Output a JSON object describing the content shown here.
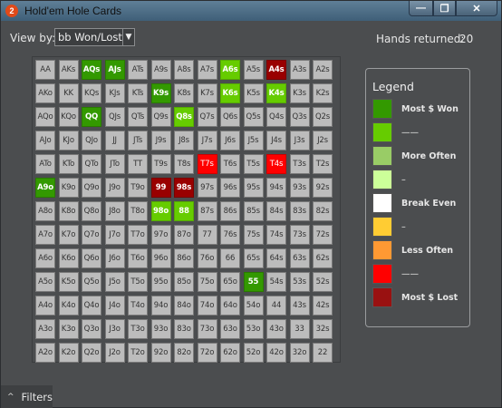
{
  "window": {
    "title": "Hold'em Hole Cards",
    "icon_symbol": "2",
    "controls": {
      "minimize": "—",
      "maximize": "❐",
      "close": "✕"
    }
  },
  "toolbar": {
    "view_by_label": "View by:",
    "view_by_value": "bb Won/Lost",
    "hands_returned_label": "Hands returned:",
    "hands_returned_value": "20"
  },
  "grid": {
    "rows": [
      [
        "AA",
        "AKs",
        "AQs",
        "AJs",
        "ATs",
        "A9s",
        "A8s",
        "A7s",
        "A6s",
        "A5s",
        "A4s",
        "A3s",
        "A2s"
      ],
      [
        "AKo",
        "KK",
        "KQs",
        "KJs",
        "KTs",
        "K9s",
        "K8s",
        "K7s",
        "K6s",
        "K5s",
        "K4s",
        "K3s",
        "K2s"
      ],
      [
        "AQo",
        "KQo",
        "QQ",
        "QJs",
        "QTs",
        "Q9s",
        "Q8s",
        "Q7s",
        "Q6s",
        "Q5s",
        "Q4s",
        "Q3s",
        "Q2s"
      ],
      [
        "AJo",
        "KJo",
        "QJo",
        "JJ",
        "JTs",
        "J9s",
        "J8s",
        "J7s",
        "J6s",
        "J5s",
        "J4s",
        "J3s",
        "J2s"
      ],
      [
        "ATo",
        "KTo",
        "QTo",
        "JTo",
        "TT",
        "T9s",
        "T8s",
        "T7s",
        "T6s",
        "T5s",
        "T4s",
        "T3s",
        "T2s"
      ],
      [
        "A9o",
        "K9o",
        "Q9o",
        "J9o",
        "T9o",
        "99",
        "98s",
        "97s",
        "96s",
        "95s",
        "94s",
        "93s",
        "92s"
      ],
      [
        "A8o",
        "K8o",
        "Q8o",
        "J8o",
        "T8o",
        "98o",
        "88",
        "87s",
        "86s",
        "85s",
        "84s",
        "83s",
        "82s"
      ],
      [
        "A7o",
        "K7o",
        "Q7o",
        "J7o",
        "T7o",
        "97o",
        "87o",
        "77",
        "76s",
        "75s",
        "74s",
        "73s",
        "72s"
      ],
      [
        "A6o",
        "K6o",
        "Q6o",
        "J6o",
        "T6o",
        "96o",
        "86o",
        "76o",
        "66",
        "65s",
        "64s",
        "63s",
        "62s"
      ],
      [
        "A5o",
        "K5o",
        "Q5o",
        "J5o",
        "T5o",
        "95o",
        "85o",
        "75o",
        "65o",
        "55",
        "54s",
        "53s",
        "52s"
      ],
      [
        "A4o",
        "K4o",
        "Q4o",
        "J4o",
        "T4o",
        "94o",
        "84o",
        "74o",
        "64o",
        "54o",
        "44",
        "43s",
        "42s"
      ],
      [
        "A3o",
        "K3o",
        "Q3o",
        "J3o",
        "T3o",
        "93o",
        "83o",
        "73o",
        "63o",
        "53o",
        "43o",
        "33",
        "32s"
      ],
      [
        "A2o",
        "K2o",
        "Q2o",
        "J2o",
        "T2o",
        "92o",
        "82o",
        "72o",
        "62o",
        "52o",
        "42o",
        "32o",
        "22"
      ]
    ],
    "status": [
      [
        "",
        "",
        "won",
        "won",
        "",
        "",
        "",
        "",
        "won2",
        "",
        "lost",
        "",
        ""
      ],
      [
        "",
        "",
        "",
        "",
        "",
        "won",
        "",
        "",
        "won2",
        "",
        "won2",
        "",
        ""
      ],
      [
        "",
        "",
        "won",
        "",
        "",
        "",
        "won2",
        "",
        "",
        "",
        "",
        "",
        ""
      ],
      [
        "",
        "",
        "",
        "",
        "",
        "",
        "",
        "",
        "",
        "",
        "",
        "",
        ""
      ],
      [
        "",
        "",
        "",
        "",
        "",
        "",
        "",
        "lost2",
        "",
        "",
        "lost2",
        "",
        ""
      ],
      [
        "won",
        "",
        "",
        "",
        "",
        "lost",
        "lost",
        "",
        "",
        "",
        "",
        "",
        ""
      ],
      [
        "",
        "",
        "",
        "",
        "",
        "won2",
        "won2",
        "",
        "",
        "",
        "",
        "",
        ""
      ],
      [
        "",
        "",
        "",
        "",
        "",
        "",
        "",
        "",
        "",
        "",
        "",
        "",
        ""
      ],
      [
        "",
        "",
        "",
        "",
        "",
        "",
        "",
        "",
        "",
        "",
        "",
        "",
        ""
      ],
      [
        "",
        "",
        "",
        "",
        "",
        "",
        "",
        "",
        "",
        "won",
        "",
        "",
        ""
      ],
      [
        "",
        "",
        "",
        "",
        "",
        "",
        "",
        "",
        "",
        "",
        "",
        "",
        ""
      ],
      [
        "",
        "",
        "",
        "",
        "",
        "",
        "",
        "",
        "",
        "",
        "",
        "",
        ""
      ],
      [
        "",
        "",
        "",
        "",
        "",
        "",
        "",
        "",
        "",
        "",
        "",
        "",
        ""
      ]
    ]
  },
  "legend": {
    "title": "Legend",
    "items": [
      {
        "label": "Most $ Won",
        "color": "#339900",
        "bold": true
      },
      {
        "label": "——",
        "color": "#66cc00",
        "bold": false
      },
      {
        "label": "More Often",
        "color": "#99cc66",
        "bold": true
      },
      {
        "label": "–",
        "color": "#ccff99",
        "bold": false
      },
      {
        "label": "Break Even",
        "color": "#ffffff",
        "bold": true
      },
      {
        "label": "–",
        "color": "#ffcc33",
        "bold": false
      },
      {
        "label": "Less Often",
        "color": "#ff9933",
        "bold": true
      },
      {
        "label": "——",
        "color": "#ff0000",
        "bold": false
      },
      {
        "label": "Most $ Lost",
        "color": "#991111",
        "bold": true
      }
    ]
  },
  "footer": {
    "filters_label": "Filters",
    "filters_caret": "^"
  }
}
